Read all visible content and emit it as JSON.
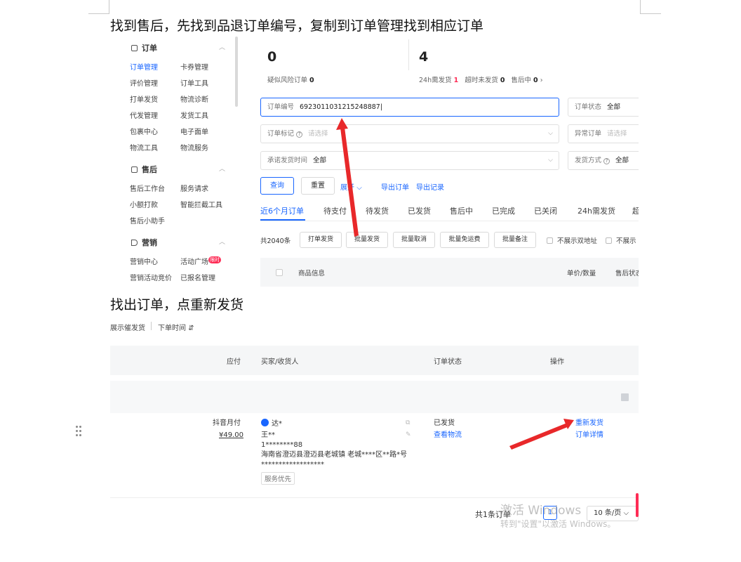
{
  "doc": {
    "line1": "找到售后，先找到品退订单编号，复制到订单管理找到相应订单",
    "line2": "找出订单，点重新发货"
  },
  "shot1": {
    "sidebar": {
      "sections": [
        {
          "title": "订单",
          "icon": "order-icon"
        },
        {
          "title": "售后",
          "icon": "aftersale-icon"
        },
        {
          "title": "营销",
          "icon": "megaphone-icon"
        }
      ],
      "order_items": [
        "订单管理",
        "卡券管理",
        "评价管理",
        "订单工具",
        "打单发货",
        "物流诊断",
        "代发管理",
        "发货工具",
        "包裹中心",
        "电子面单",
        "物流工具",
        "物流服务"
      ],
      "aftersale_items": [
        "售后工作台",
        "服务请求",
        "小额打款",
        "智能拦截工具",
        "售后小助手"
      ],
      "marketing_items": [
        "营销中心",
        "活动广场",
        "营销活动竞价",
        "已报名管理"
      ],
      "hot_badge": "限时"
    },
    "stats": {
      "left_num": "0",
      "left_label": "疑似风险订单",
      "left_value": "0",
      "right_num": "4",
      "r1_label": "24h需发货",
      "r1_value": "1",
      "r2_label": "超时未发货",
      "r2_value": "0",
      "r3_label": "售后中",
      "r3_value": "0"
    },
    "filters": {
      "order_no_label": "订单编号",
      "order_no_value": "6923011031215248887",
      "status_label": "订单状态",
      "status_value": "全部",
      "mark_label": "订单标记",
      "mark_placeholder": "请选择",
      "abnormal_label": "异常订单",
      "abnormal_placeholder": "请选择",
      "promise_label": "承诺发货时间",
      "promise_value": "全部",
      "ship_label": "发货方式",
      "ship_value": "全部"
    },
    "actions": {
      "query": "查询",
      "reset": "重置",
      "expand": "展开",
      "export": "导出订单",
      "export_log": "导出记录"
    },
    "tabs": [
      "近6个月订单",
      "待支付",
      "待发货",
      "已发货",
      "售后中",
      "已完成",
      "已关闭",
      "24h需发货",
      "超"
    ],
    "batch": {
      "count": "共2040条",
      "buttons": [
        "打单发货",
        "批量发货",
        "批量取消",
        "批量免运费",
        "批量备注"
      ],
      "cb1": "不展示双地址",
      "cb2": "不展示"
    },
    "table_head": {
      "product": "商品信息",
      "price_qty": "单价/数量",
      "after_status": "售后状态"
    }
  },
  "shot2": {
    "top_left": "展示催发货",
    "top_sort": "下单时间",
    "head": {
      "pay": "应付",
      "buyer": "买家/收货人",
      "status": "订单状态",
      "ops": "操作"
    },
    "row": {
      "pay_method": "抖音月付",
      "amount": "¥49.00",
      "buyer": "达*",
      "receiver": "王**",
      "phone": "1********88",
      "address": "海南省澄迈县澄迈县老城镇 老城****区**路*号",
      "address2": "******************",
      "tag": "服务优先",
      "status": "已发货",
      "view_logistics": "查看物流",
      "resend": "重新发货",
      "detail": "订单详情"
    },
    "pager": {
      "total": "共1条订单",
      "current": "1",
      "size": "10 条/页"
    }
  },
  "watermark": {
    "line1": "激活 Windows",
    "line2": "转到\"设置\"以激活 Windows。"
  },
  "colors": {
    "accent": "#1966ff",
    "arrow": "#e8282a",
    "hot": "#fe2c55"
  }
}
